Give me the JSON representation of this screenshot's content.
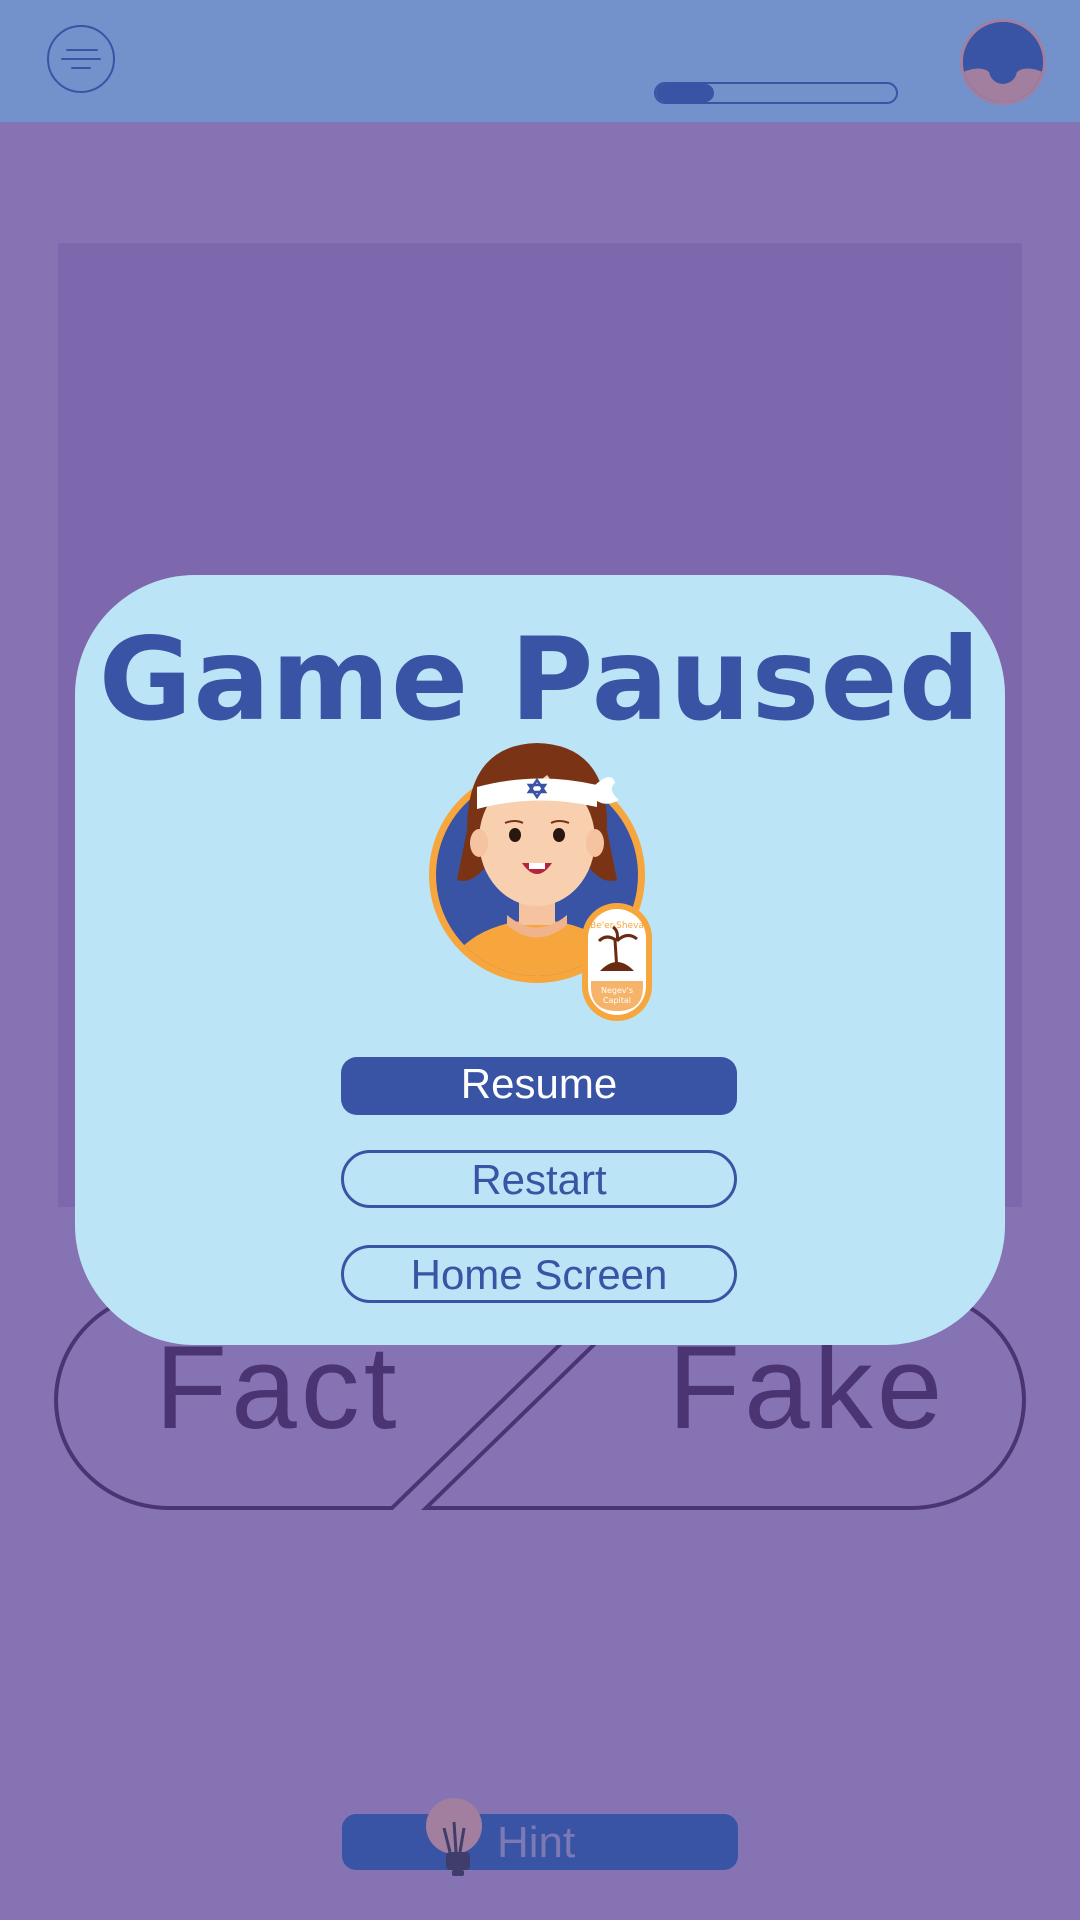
{
  "top_bar": {
    "menu_icon": "hamburger-menu-icon",
    "progress": 0.24,
    "avatar_icon": "player-avatar-icon"
  },
  "board": {
    "fact_label": "Fact",
    "fake_label": "Fake"
  },
  "hint": {
    "label": "Hint",
    "icon": "lightbulb-icon"
  },
  "pause_modal": {
    "title": "Game Paused",
    "badge": {
      "city": "Be'er-Sheva",
      "caption_line1": "Negev's",
      "caption_line2": "Capital"
    },
    "buttons": {
      "resume": "Resume",
      "restart": "Restart",
      "home": "Home Screen"
    }
  },
  "colors": {
    "background": "#8673b3",
    "top_bar": "#7391cb",
    "accent": "#3a54a5",
    "modal": "#bbe5f7",
    "character_badge": "#f6a63c"
  }
}
